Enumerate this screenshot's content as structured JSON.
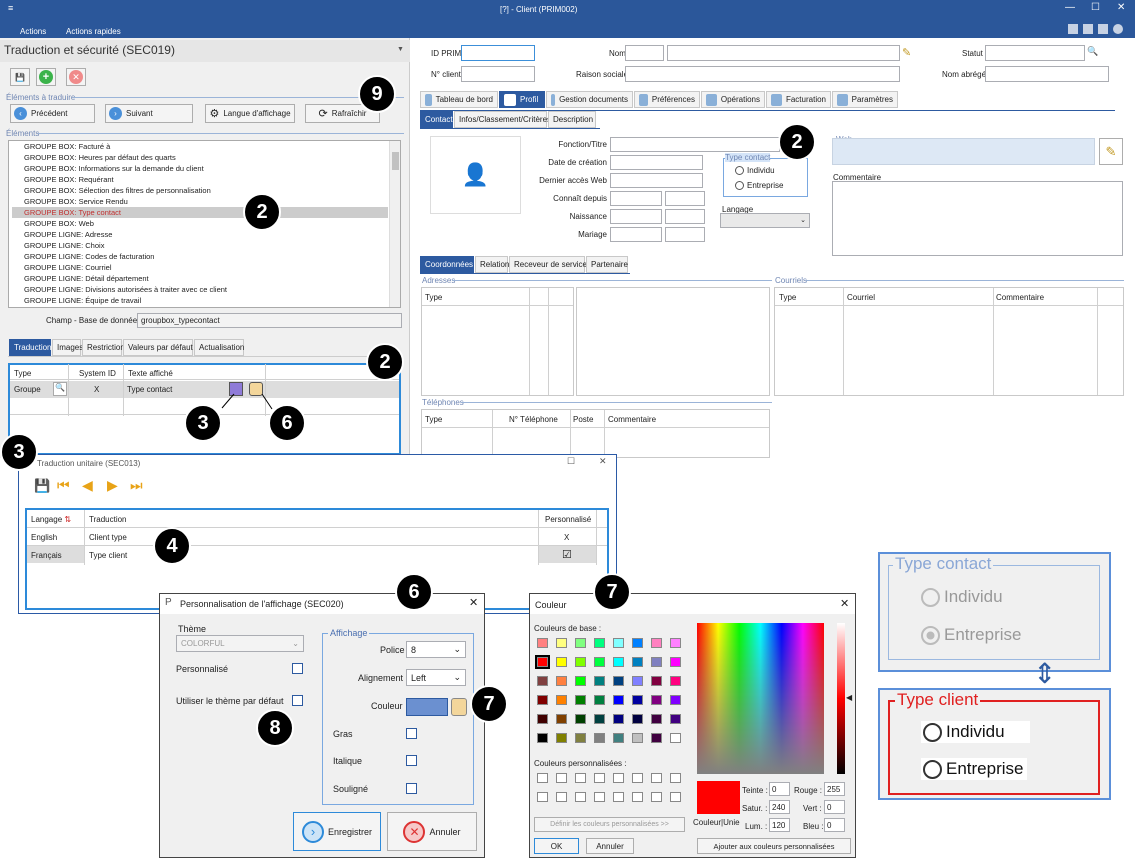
{
  "titlebar": {
    "title": "[?] - Client (PRIM002)"
  },
  "menu": {
    "actions": "Actions",
    "quick": "Actions rapides"
  },
  "left": {
    "title": "Traduction et sécurité (SEC019)",
    "sec_items": "Éléments à traduire",
    "prev": "Précédent",
    "next": "Suivant",
    "lang": "Langue d'affichage",
    "refresh": "Rafraîchir",
    "sec_elements": "Éléments",
    "elements": [
      "GROUPE BOX: Facturé à",
      "GROUPE BOX: Heures par défaut des quarts",
      "GROUPE BOX: Informations sur la demande du client",
      "GROUPE BOX: Requérant",
      "GROUPE BOX: Sélection des filtres de personnalisation",
      "GROUPE BOX: Service Rendu",
      "GROUPE BOX: Type contact",
      "GROUPE BOX: Web",
      "GROUPE LIGNE: Adresse",
      "GROUPE LIGNE: Choix",
      "GROUPE LIGNE: Codes de facturation",
      "GROUPE LIGNE: Courriel",
      "GROUPE LIGNE: Détail département",
      "GROUPE LIGNE: Divisions autorisées à traiter avec ce client",
      "GROUPE LIGNE: Équipe de travail"
    ],
    "field_label": "Champ - Base de données",
    "field_value": "groupbox_typecontact",
    "tabs": [
      "Traduction",
      "Images",
      "Restriction",
      "Valeurs par défaut",
      "Actualisation"
    ],
    "grid_headers": [
      "Type",
      "System ID",
      "Texte affiché"
    ],
    "row": {
      "type": "Groupe",
      "sysid": "X",
      "text": "Type contact"
    }
  },
  "client": {
    "id_prim": "ID PRIM",
    "no_client": "N° client",
    "nom": "Nom",
    "raison": "Raison sociale",
    "statut": "Statut",
    "nom_abrege": "Nom abrégé",
    "tabs": [
      "Tableau de bord",
      "Profil",
      "Gestion documents",
      "Préférences",
      "Opérations",
      "Facturation",
      "Paramètres"
    ],
    "subtabs": [
      "Contact",
      "Infos/Classement/Critères",
      "Description"
    ],
    "fields": [
      "Fonction/Titre",
      "Date de création",
      "Dernier accès Web",
      "Connaît depuis",
      "Naissance",
      "Mariage"
    ],
    "type_contact": "Type contact",
    "individu": "Individu",
    "entreprise": "Entreprise",
    "langage": "Langage",
    "web": "Web",
    "commentaire": "Commentaire",
    "coord_tabs": [
      "Coordonnées",
      "Relation",
      "Receveur de service",
      "Partenaire"
    ],
    "adresses": "Adresses",
    "courriels": "Courriels",
    "telephones": "Téléphones",
    "addr_head": "Type",
    "courr_heads": [
      "Type",
      "Courriel",
      "Commentaire"
    ],
    "tel_heads": [
      "Type",
      "N° Téléphone",
      "Poste",
      "Commentaire"
    ]
  },
  "sec013": {
    "title": "Traduction unitaire (SEC013)",
    "heads": [
      "Langage",
      "Traduction",
      "Personnalisé"
    ],
    "rows": [
      {
        "lang": "English",
        "trad": "Client type",
        "pers": "X"
      },
      {
        "lang": "Français",
        "trad": "Type client",
        "pers": "☑"
      }
    ]
  },
  "sec020": {
    "title": "Personnalisation de l'affichage (SEC020)",
    "theme": "Thème",
    "theme_value": "COLORFUL",
    "personnalise": "Personnalisé",
    "use_default": "Utiliser le thème par défaut",
    "affichage": "Affichage",
    "police": "Police",
    "police_value": "8",
    "alignement": "Alignement",
    "align_value": "Left",
    "couleur": "Couleur",
    "gras": "Gras",
    "italique": "Italique",
    "souligne": "Souligné",
    "save": "Enregistrer",
    "cancel": "Annuler",
    "color_value": "#6b90d0"
  },
  "couleur": {
    "title": "Couleur",
    "base": "Couleurs de base :",
    "custom": "Couleurs personnalisées :",
    "define": "Définir les couleurs personnalisées >>",
    "ok": "OK",
    "cancel": "Annuler",
    "add": "Ajouter aux couleurs personnalisées",
    "solid": "Couleur|Unie",
    "teinte": "Teinte :",
    "teinte_v": "0",
    "satur": "Satur. :",
    "satur_v": "240",
    "lum": "Lum. :",
    "lum_v": "120",
    "rouge": "Rouge :",
    "rouge_v": "255",
    "vert": "Vert :",
    "vert_v": "0",
    "bleu": "Bleu :",
    "bleu_v": "0",
    "palette": [
      "#ff8080",
      "#ffff80",
      "#80ff80",
      "#00ff80",
      "#80ffff",
      "#0080ff",
      "#ff80c0",
      "#ff80ff",
      "#ff0000",
      "#ffff00",
      "#80ff00",
      "#00ff40",
      "#00ffff",
      "#0080c0",
      "#8080c0",
      "#ff00ff",
      "#804040",
      "#ff8040",
      "#00ff00",
      "#008080",
      "#004080",
      "#8080ff",
      "#800040",
      "#ff0080",
      "#800000",
      "#ff8000",
      "#008000",
      "#008040",
      "#0000ff",
      "#0000a0",
      "#800080",
      "#8000ff",
      "#400000",
      "#804000",
      "#004000",
      "#004040",
      "#000080",
      "#000040",
      "#400040",
      "#400080",
      "#000000",
      "#808000",
      "#808040",
      "#808080",
      "#408080",
      "#c0c0c0",
      "#400040",
      "#ffffff"
    ]
  },
  "callout": {
    "title_contact": "Type contact",
    "title_client": "Type client",
    "individu": "Individu",
    "entreprise": "Entreprise"
  },
  "badges": [
    "9",
    "2",
    "2",
    "3",
    "6",
    "3",
    "4",
    "6",
    "7",
    "7",
    "8",
    "2"
  ]
}
